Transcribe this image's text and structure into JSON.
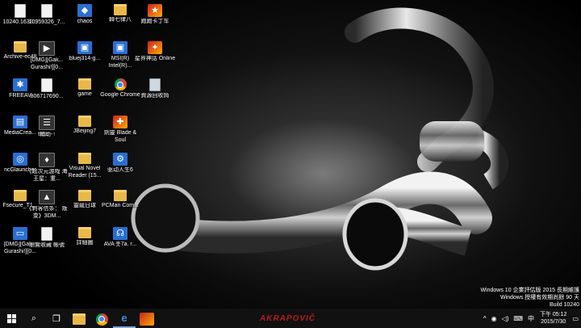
{
  "desktop_icons": [
    {
      "label": "10240.1638...",
      "glyph": "g-file",
      "sym": ""
    },
    {
      "label": "10959326_7...",
      "glyph": "g-file",
      "sym": ""
    },
    {
      "label": "chaos",
      "glyph": "g-blue",
      "sym": "◆"
    },
    {
      "label": "韓七律八",
      "glyph": "g-folder",
      "sym": ""
    },
    {
      "label": "跑跑卡丁车",
      "glyph": "g-game",
      "sym": "★"
    },
    {
      "label": "Archive-ec48",
      "glyph": "g-folder",
      "sym": ""
    },
    {
      "label": "[DMG][Gak... Gurashi!][0...",
      "glyph": "g-dark",
      "sym": "▶"
    },
    {
      "label": "bluej314-g...",
      "glyph": "g-blue",
      "sym": "▣"
    },
    {
      "label": "MSI(R) Intel(R)...",
      "glyph": "g-blue",
      "sym": "▣"
    },
    {
      "label": "星界神話 Online",
      "glyph": "g-game",
      "sym": "✦"
    },
    {
      "label": "FREEAV",
      "glyph": "g-blue",
      "sym": "✱"
    },
    {
      "label": "806717690...",
      "glyph": "g-file",
      "sym": ""
    },
    {
      "label": "game",
      "glyph": "g-folder",
      "sym": ""
    },
    {
      "label": "Google Chrome",
      "glyph": "g-chrome",
      "sym": ""
    },
    {
      "label": "資源回收筒",
      "glyph": "g-recycle",
      "sym": ""
    },
    {
      "label": "MediaCrea...",
      "glyph": "g-blue",
      "sym": "▤"
    },
    {
      "label": "t輔助-↑",
      "glyph": "g-dark",
      "sym": "☰"
    },
    {
      "label": "JBeijing7",
      "glyph": "g-folder",
      "sym": ""
    },
    {
      "label": "劍靈 Blade & Soul",
      "glyph": "g-game",
      "sym": "✚"
    },
    {
      "label": "",
      "glyph": "",
      "sym": ""
    },
    {
      "label": "ncGlauncher",
      "glyph": "g-blue",
      "sym": "◎"
    },
    {
      "label": "《超次元游戏 海王星：重...",
      "glyph": "g-dark",
      "sym": "♦"
    },
    {
      "label": "Visual Novel Reader (15...",
      "glyph": "g-folder",
      "sym": ""
    },
    {
      "label": "驱动人生6",
      "glyph": "g-blue",
      "sym": "⚙"
    },
    {
      "label": "",
      "glyph": "",
      "sym": ""
    },
    {
      "label": "Fsecure_T1...",
      "glyph": "g-folder",
      "sym": ""
    },
    {
      "label": "《刺客信条： 叛变》3DM...",
      "glyph": "g-dark",
      "sym": "▲"
    },
    {
      "label": "靈龍日球",
      "glyph": "g-folder",
      "sym": ""
    },
    {
      "label": "PCMan Com...",
      "glyph": "g-folder",
      "sym": ""
    },
    {
      "label": "",
      "glyph": "",
      "sym": ""
    },
    {
      "label": "[DMG][Gak... Gurashi!][0...",
      "glyph": "g-blue",
      "sym": "▭"
    },
    {
      "label": "瀏覽收藏 帳號",
      "glyph": "g-file",
      "sym": ""
    },
    {
      "label": "詳細圖",
      "glyph": "g-folder",
      "sym": ""
    },
    {
      "label": "AVA 촛7a. r...",
      "glyph": "g-blue",
      "sym": "☊"
    },
    {
      "label": "",
      "glyph": "",
      "sym": ""
    }
  ],
  "sysinfo": {
    "line1": "Windows 10 企業評估版 2015 長期維護",
    "line2": "Windows 授權有效期尚餘 90 天",
    "line3": "Build 10240"
  },
  "taskbar": {
    "search_glyph": "⌕",
    "taskview_glyph": "❐",
    "brand": "AKRAPOVIČ",
    "tray_chevron": "^",
    "tray_network": "◉",
    "tray_volume": "◁)",
    "tray_keyboard": "⌨",
    "ime": "中",
    "notifications": "▭",
    "time": "下午 05:12",
    "date": "2015/7/30"
  },
  "colors": {
    "accent": "#7aa7e0",
    "brand": "#b51c1c",
    "taskbar": "#111111"
  }
}
